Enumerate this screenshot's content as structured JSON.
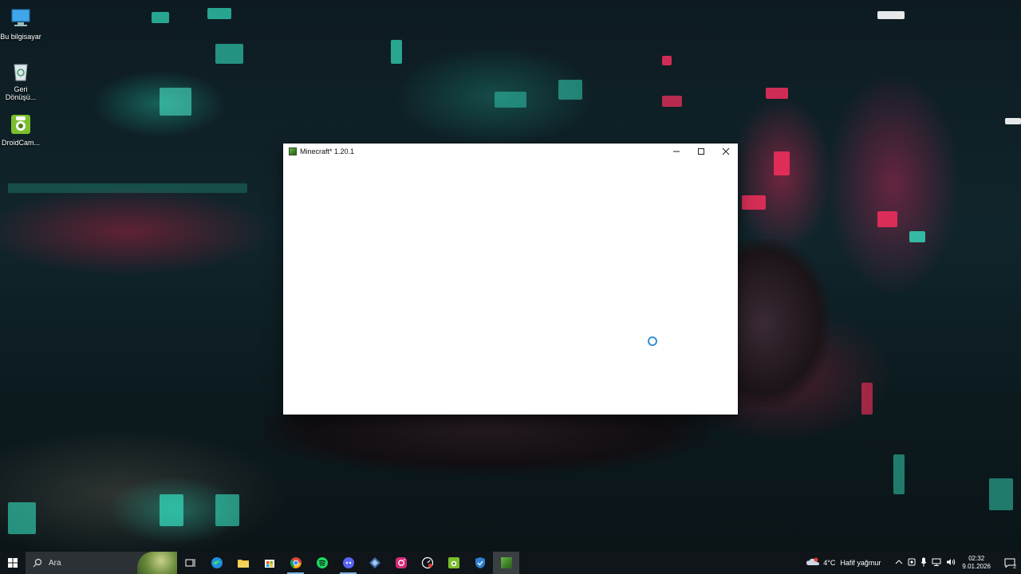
{
  "desktop": {
    "icons": [
      {
        "label": "Bu bilgisayar",
        "icon": "computer-icon"
      },
      {
        "label": "Geri Dönüşü...",
        "icon": "recycle-bin-icon"
      },
      {
        "label": "DroidCam...",
        "icon": "droidcam-icon"
      }
    ]
  },
  "window": {
    "title": "Minecraft* 1.20.1",
    "controls": {
      "minimize": "—",
      "maximize": "☐",
      "close": "✕"
    },
    "loading_indicator": "spinner-icon"
  },
  "taskbar": {
    "search_placeholder": "Ara",
    "apps": [
      {
        "name": "task-view",
        "icon": "task-view-icon"
      },
      {
        "name": "edge",
        "icon": "edge-icon"
      },
      {
        "name": "file-explorer",
        "icon": "folder-icon"
      },
      {
        "name": "store",
        "icon": "store-icon"
      },
      {
        "name": "chrome",
        "icon": "chrome-icon"
      },
      {
        "name": "spotify",
        "icon": "spotify-icon"
      },
      {
        "name": "discord",
        "icon": "discord-icon"
      },
      {
        "name": "app-diamond",
        "icon": "diamond-icon"
      },
      {
        "name": "instagram",
        "icon": "instagram-icon"
      },
      {
        "name": "speedometer",
        "icon": "gauge-icon"
      },
      {
        "name": "droidcam",
        "icon": "droidcam-icon"
      },
      {
        "name": "vpn",
        "icon": "shield-icon"
      },
      {
        "name": "minecraft",
        "icon": "minecraft-icon"
      }
    ],
    "weather": {
      "temp": "4°C",
      "condition": "Hafif yağmur"
    },
    "clock": {
      "time": "02:32",
      "date": "9.01.2026"
    },
    "notification_count": "2"
  },
  "colors": {
    "taskbar_bg": "#10161a",
    "accent": "#7fb3e0",
    "spinner": "#3a8fd0"
  }
}
